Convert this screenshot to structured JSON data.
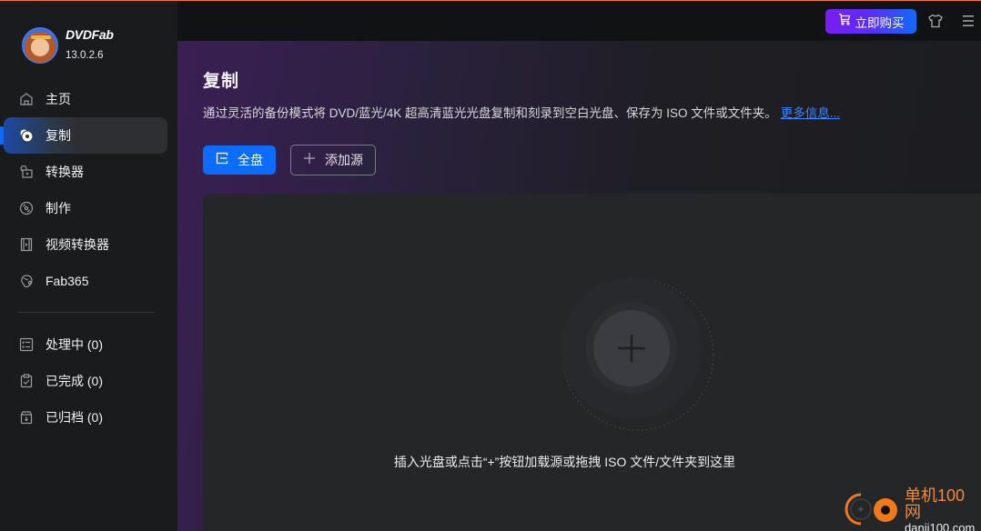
{
  "app": {
    "brand": "DVDFab",
    "version": "13.0.2.6"
  },
  "sidebar": {
    "items": [
      {
        "label": "主页",
        "icon": "home-icon",
        "active": false
      },
      {
        "label": "复制",
        "icon": "disc-copy-icon",
        "active": true
      },
      {
        "label": "转换器",
        "icon": "converter-icon",
        "active": false
      },
      {
        "label": "制作",
        "icon": "disc-create-icon",
        "active": false
      },
      {
        "label": "视频转换器",
        "icon": "film-icon",
        "active": false
      },
      {
        "label": "Fab365",
        "icon": "fab365-icon",
        "active": false
      }
    ],
    "queue": [
      {
        "label": "处理中 (0)",
        "icon": "task-list-icon"
      },
      {
        "label": "已完成 (0)",
        "icon": "clipboard-check-icon"
      },
      {
        "label": "已归档 (0)",
        "icon": "archive-icon"
      }
    ]
  },
  "topbar": {
    "buy_label": "立即购买",
    "skin_icon": "tshirt-icon",
    "menu_icon": "menu-icon"
  },
  "main": {
    "title": "复制",
    "description": "通过灵活的备份模式将 DVD/蓝光/4K 超高清蓝光光盘复制和刻录到空白光盘、保存为 ISO 文件或文件夹。",
    "more_info": "更多信息...",
    "full_disc_label": "全盘",
    "add_source_label": "添加源",
    "drop_hint": "插入光盘或点击“+”按钮加载源或拖拽 ISO 文件/文件夹到这里"
  },
  "watermark": {
    "cn": "单机100网",
    "en": "danji100.com"
  },
  "colors": {
    "accent_blue": "#0b6cff",
    "buy_gradient_start": "#7a1cf2",
    "buy_gradient_end": "#0f6bff",
    "link": "#3f86ff",
    "top_accent": "#f07a1a"
  }
}
